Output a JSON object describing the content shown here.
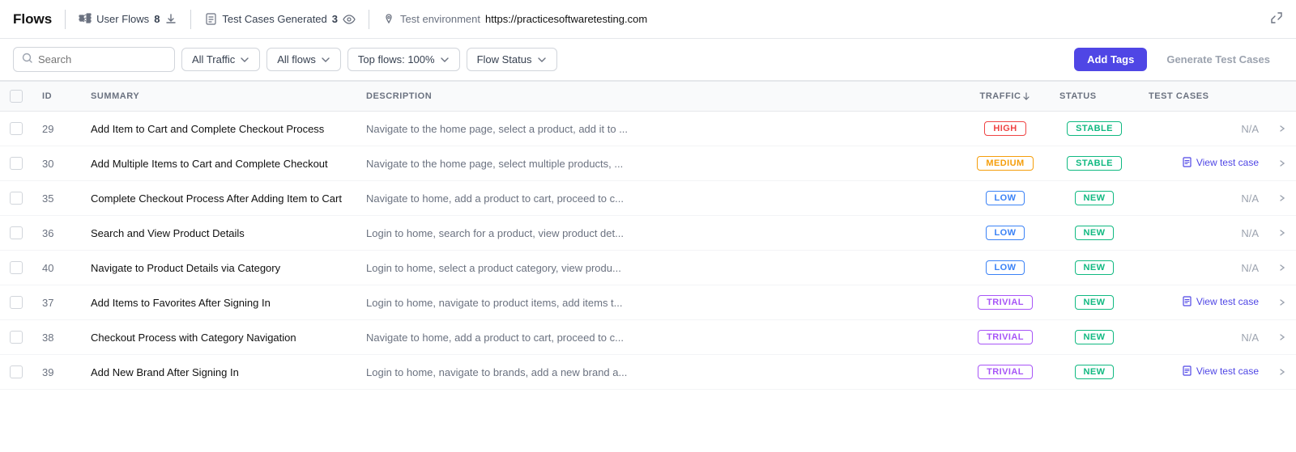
{
  "topbar": {
    "title": "Flows",
    "user_flows_label": "User Flows",
    "user_flows_count": "8",
    "test_cases_label": "Test Cases Generated",
    "test_cases_count": "3",
    "env_label": "Test environment",
    "env_url": "https://practicesoftwaretesting.com"
  },
  "toolbar": {
    "search_placeholder": "Search",
    "filter1": "All Traffic",
    "filter2": "All flows",
    "filter3": "Top flows: 100%",
    "filter4": "Flow Status",
    "add_tags": "Add Tags",
    "generate_test_cases": "Generate Test Cases"
  },
  "table": {
    "headers": {
      "id": "ID",
      "summary": "SUMMARY",
      "description": "DESCRIPTION",
      "traffic": "TRAFFIC",
      "status": "STATUS",
      "test_cases": "TEST CASES"
    },
    "rows": [
      {
        "id": "29",
        "summary": "Add Item to Cart and Complete Checkout Process",
        "description": "Navigate to the home page, select a product, add it to ...",
        "traffic": "HIGH",
        "traffic_class": "badge-high",
        "status": "STABLE",
        "status_class": "badge-stable",
        "test_case_label": "N/A",
        "has_test_case": false
      },
      {
        "id": "30",
        "summary": "Add Multiple Items to Cart and Complete Checkout",
        "description": "Navigate to the home page, select multiple products, ...",
        "traffic": "MEDIUM",
        "traffic_class": "badge-medium",
        "status": "STABLE",
        "status_class": "badge-stable",
        "test_case_label": "View test case",
        "has_test_case": true
      },
      {
        "id": "35",
        "summary": "Complete Checkout Process After Adding Item to Cart",
        "description": "Navigate to home, add a product to cart, proceed to c...",
        "traffic": "LOW",
        "traffic_class": "badge-low",
        "status": "NEW",
        "status_class": "badge-new",
        "test_case_label": "N/A",
        "has_test_case": false
      },
      {
        "id": "36",
        "summary": "Search and View Product Details",
        "description": "Login to home, search for a product, view product det...",
        "traffic": "LOW",
        "traffic_class": "badge-low",
        "status": "NEW",
        "status_class": "badge-new",
        "test_case_label": "N/A",
        "has_test_case": false
      },
      {
        "id": "40",
        "summary": "Navigate to Product Details via Category",
        "description": "Login to home, select a product category, view produ...",
        "traffic": "LOW",
        "traffic_class": "badge-low",
        "status": "NEW",
        "status_class": "badge-new",
        "test_case_label": "N/A",
        "has_test_case": false
      },
      {
        "id": "37",
        "summary": "Add Items to Favorites After Signing In",
        "description": "Login to home, navigate to product items, add items t...",
        "traffic": "TRIVIAL",
        "traffic_class": "badge-trivial",
        "status": "NEW",
        "status_class": "badge-new",
        "test_case_label": "View test case",
        "has_test_case": true
      },
      {
        "id": "38",
        "summary": "Checkout Process with Category Navigation",
        "description": "Navigate to home, add a product to cart, proceed to c...",
        "traffic": "TRIVIAL",
        "traffic_class": "badge-trivial",
        "status": "NEW",
        "status_class": "badge-new",
        "test_case_label": "N/A",
        "has_test_case": false
      },
      {
        "id": "39",
        "summary": "Add New Brand After Signing In",
        "description": "Login to home, navigate to brands, add a new brand a...",
        "traffic": "TRIVIAL",
        "traffic_class": "badge-trivial",
        "status": "NEW",
        "status_class": "badge-new",
        "test_case_label": "View test case",
        "has_test_case": true
      }
    ]
  }
}
